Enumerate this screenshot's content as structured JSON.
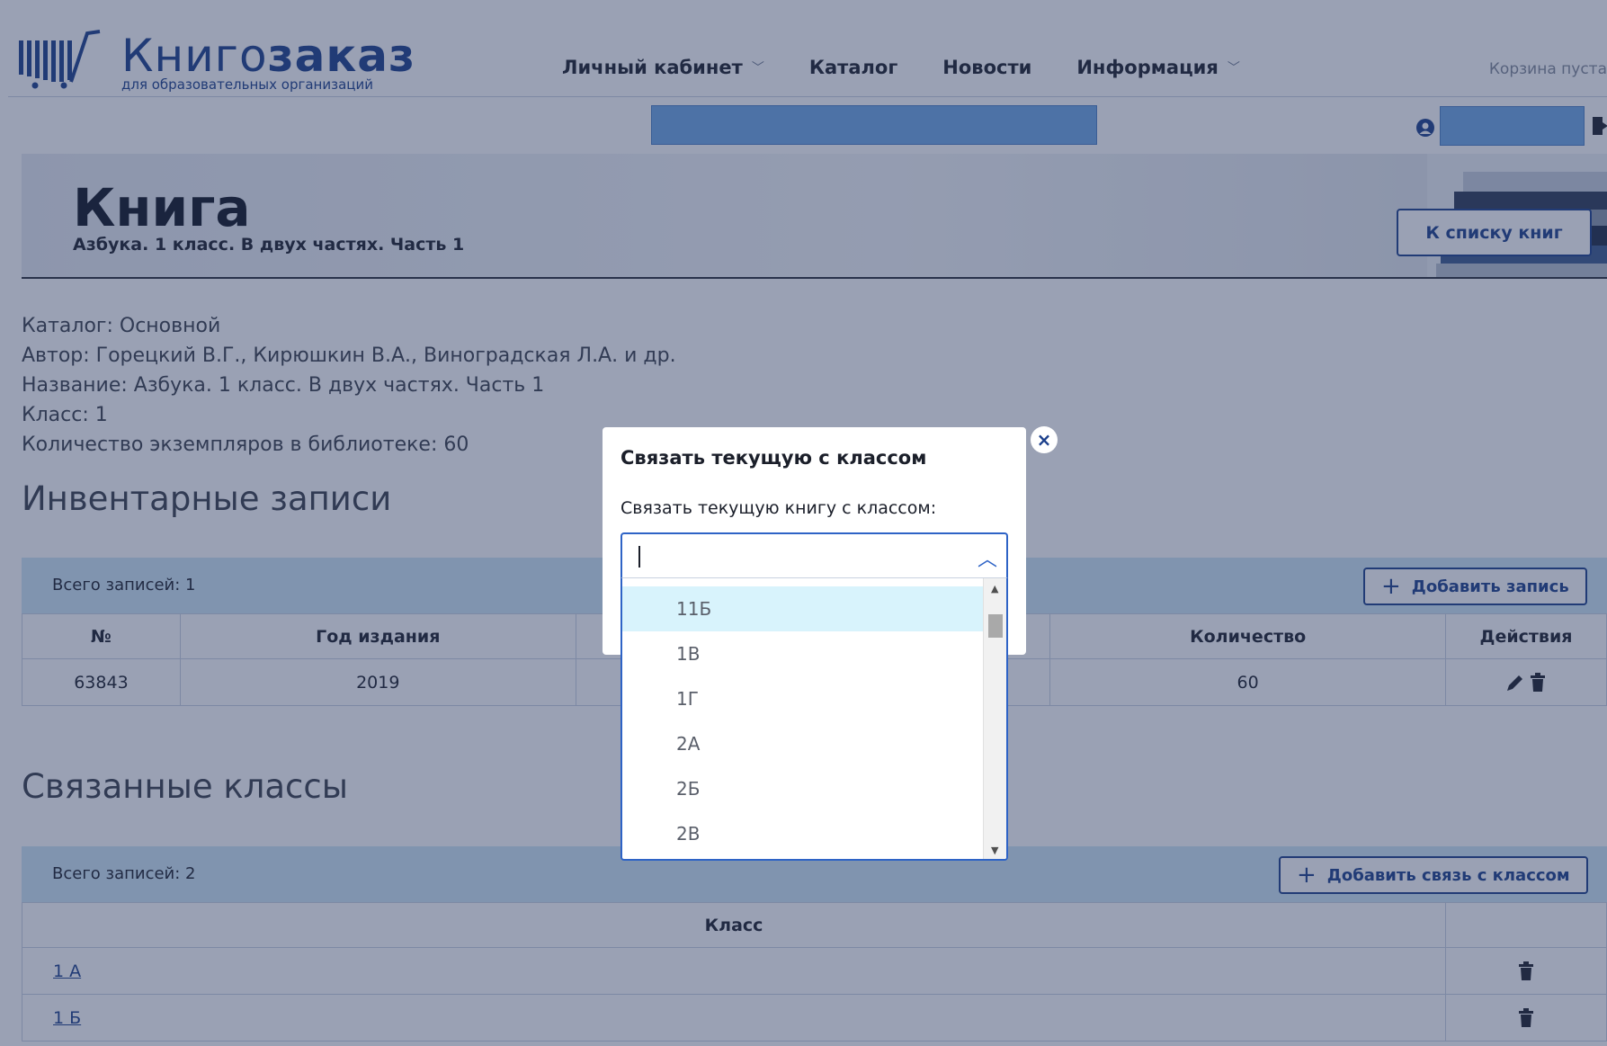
{
  "header": {
    "logo_main_light": "Книго",
    "logo_main_bold": "заказ",
    "logo_sub": "для образовательных организаций",
    "nav": [
      {
        "label": "Личный кабинет",
        "has_dropdown": true
      },
      {
        "label": "Каталог",
        "has_dropdown": false
      },
      {
        "label": "Новости",
        "has_dropdown": false
      },
      {
        "label": "Информация",
        "has_dropdown": true
      }
    ],
    "cart_text": "Корзина пуста"
  },
  "banner": {
    "title": "Книга",
    "subtitle": "Азбука. 1 класс. В двух частях. Часть 1",
    "back_button": "К списку книг"
  },
  "info": {
    "lines": [
      "Каталог: Основной",
      "Автор: Горецкий В.Г., Кирюшкин В.А., Виноградская Л.А. и др.",
      "Название: Азбука. 1 класс. В двух частях. Часть 1",
      "Класс: 1",
      "Количество экземпляров в библиотеке: 60"
    ]
  },
  "inventory": {
    "heading": "Инвентарные записи",
    "count_text": "Всего записей: 1",
    "add_button": "Добавить запись",
    "columns": [
      "№",
      "Год издания",
      "",
      "Количество",
      "Действия"
    ],
    "rows": [
      {
        "num": "63843",
        "year": "2019",
        "hidden": "",
        "qty": "60"
      }
    ]
  },
  "classes": {
    "heading": "Связанные классы",
    "count_text": "Всего записей: 2",
    "add_button": "Добавить связь с классом",
    "columns": [
      "Класс",
      ""
    ],
    "rows": [
      {
        "label": "1 А"
      },
      {
        "label": "1 Б"
      }
    ]
  },
  "modal": {
    "title": "Связать текущую с классом",
    "label": "Связать текущую книгу с классом:",
    "select_value": "",
    "options": [
      "11Б",
      "1В",
      "1Г",
      "2А",
      "2Б",
      "2В"
    ],
    "highlighted_index": 0
  },
  "colors": {
    "brand": "#1b3f8b",
    "select_border": "#2e63c6",
    "option_highlight": "#d8f3fc",
    "table_bar": "#cfe6f5",
    "overlay": "rgba(40,55,95,0.47)"
  }
}
